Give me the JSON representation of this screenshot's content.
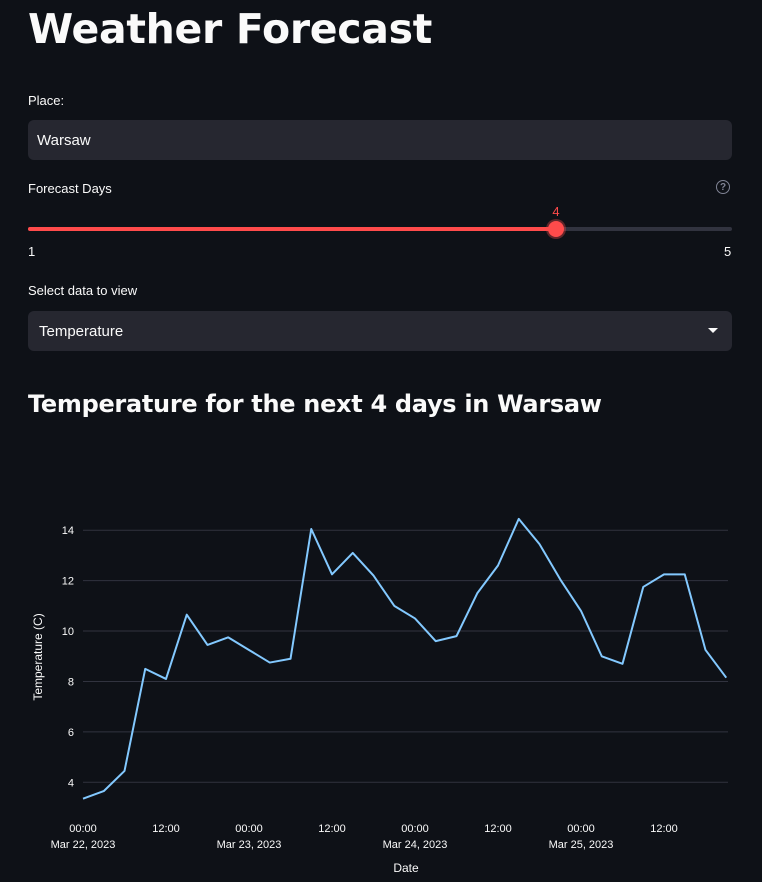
{
  "app": {
    "title": "Weather Forecast"
  },
  "place": {
    "label": "Place:",
    "value": "Warsaw"
  },
  "forecast_days": {
    "label": "Forecast Days",
    "help_icon": "question-circle-icon",
    "min": 1,
    "max": 5,
    "value": 4,
    "min_label": "1",
    "max_label": "5",
    "value_label": "4"
  },
  "data_select": {
    "label": "Select data to view",
    "selected": "Temperature"
  },
  "subheader": "Temperature for the next 4 days in Warsaw",
  "colors": {
    "accent": "#ff4b4b",
    "line": "#83c9ff",
    "background": "#0e1117",
    "input_bg": "#262730"
  },
  "chart_data": {
    "type": "line",
    "x_start": "2023-03-22 00:00",
    "x_step_hours": 3,
    "y": [
      3.35,
      3.65,
      4.45,
      8.5,
      8.1,
      10.65,
      9.45,
      9.75,
      9.25,
      8.75,
      8.9,
      14.05,
      12.25,
      13.1,
      12.2,
      11.0,
      10.5,
      9.6,
      9.8,
      11.5,
      12.6,
      14.45,
      13.45,
      12.05,
      10.8,
      9.0,
      8.7,
      11.75,
      12.25,
      12.25,
      9.25,
      8.15
    ],
    "xlabel": "Date",
    "ylabel": "Temperature (C)",
    "ylim": [
      2.9,
      15.2
    ],
    "yticks": [
      4,
      6,
      8,
      10,
      12,
      14
    ],
    "xticks": [
      {
        "hour": 0,
        "time": "00:00",
        "date": "Mar 22, 2023"
      },
      {
        "hour": 12,
        "time": "12:00",
        "date": ""
      },
      {
        "hour": 24,
        "time": "00:00",
        "date": "Mar 23, 2023"
      },
      {
        "hour": 36,
        "time": "12:00",
        "date": ""
      },
      {
        "hour": 48,
        "time": "00:00",
        "date": "Mar 24, 2023"
      },
      {
        "hour": 60,
        "time": "12:00",
        "date": ""
      },
      {
        "hour": 72,
        "time": "00:00",
        "date": "Mar 25, 2023"
      },
      {
        "hour": 84,
        "time": "12:00",
        "date": ""
      }
    ],
    "grid": true
  }
}
